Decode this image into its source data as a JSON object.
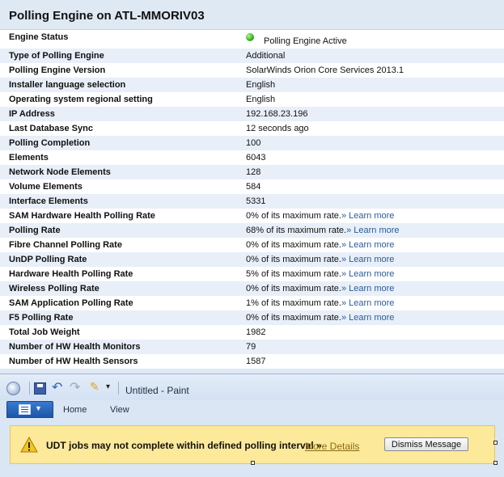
{
  "panel": {
    "title": "Polling Engine on ATL-MMORIV03",
    "status_label": "Engine Status",
    "status_value": "Polling Engine Active",
    "rows": [
      {
        "label": "Type of Polling Engine",
        "value": "Additional"
      },
      {
        "label": "Polling Engine Version",
        "value": "SolarWinds Orion Core Services 2013.1"
      },
      {
        "label": "Installer language selection",
        "value": "English"
      },
      {
        "label": "Operating system regional setting",
        "value": "English"
      },
      {
        "label": "IP Address",
        "value": "192.168.23.196"
      },
      {
        "label": "Last Database Sync",
        "value": "12 seconds ago"
      },
      {
        "label": "Polling Completion",
        "value": "100"
      },
      {
        "label": "Elements",
        "value": "6043"
      },
      {
        "label": "Network Node Elements",
        "value": "128"
      },
      {
        "label": "Volume Elements",
        "value": "584"
      },
      {
        "label": "Interface Elements",
        "value": "5331"
      },
      {
        "label": "SAM Hardware Health Polling Rate",
        "value": "0% of its maximum rate.",
        "link": "» Learn more"
      },
      {
        "label": "Polling Rate",
        "value": "68% of its maximum rate.",
        "link": "» Learn more"
      },
      {
        "label": "Fibre Channel Polling Rate",
        "value": "0% of its maximum rate.",
        "link": "» Learn more"
      },
      {
        "label": "UnDP Polling Rate",
        "value": "0% of its maximum rate.",
        "link": "» Learn more"
      },
      {
        "label": "Hardware Health Polling Rate",
        "value": "5% of its maximum rate.",
        "link": "» Learn more"
      },
      {
        "label": "Wireless Polling Rate",
        "value": "0% of its maximum rate.",
        "link": "» Learn more"
      },
      {
        "label": "SAM Application Polling Rate",
        "value": "1% of its maximum rate.",
        "link": "» Learn more"
      },
      {
        "label": "F5 Polling Rate",
        "value": "0% of its maximum rate.",
        "link": "» Learn more"
      },
      {
        "label": "Total Job Weight",
        "value": "1982"
      },
      {
        "label": "Number of HW Health Monitors",
        "value": "79"
      },
      {
        "label": "Number of HW Health Sensors",
        "value": "1587"
      }
    ]
  },
  "paint": {
    "window_title": "Untitled - Paint",
    "tabs": [
      "Home",
      "View"
    ],
    "icons": [
      "paint-app-icon",
      "save-icon",
      "undo-icon",
      "redo-icon",
      "customize-icon",
      "quick-access-dropdown-icon",
      "app-menu-icon"
    ]
  },
  "notification": {
    "message": "UDT jobs may not complete within defined polling interval",
    "link_prefix": "»",
    "link": "More Details",
    "dismiss": "Dismiss Message"
  },
  "colors": {
    "header_bg": "#dfe9f4",
    "alt_row": "#e8eff8",
    "link": "#2a5c9a",
    "status_active": "#3fb51f",
    "notify_bg": "#fce99a"
  }
}
